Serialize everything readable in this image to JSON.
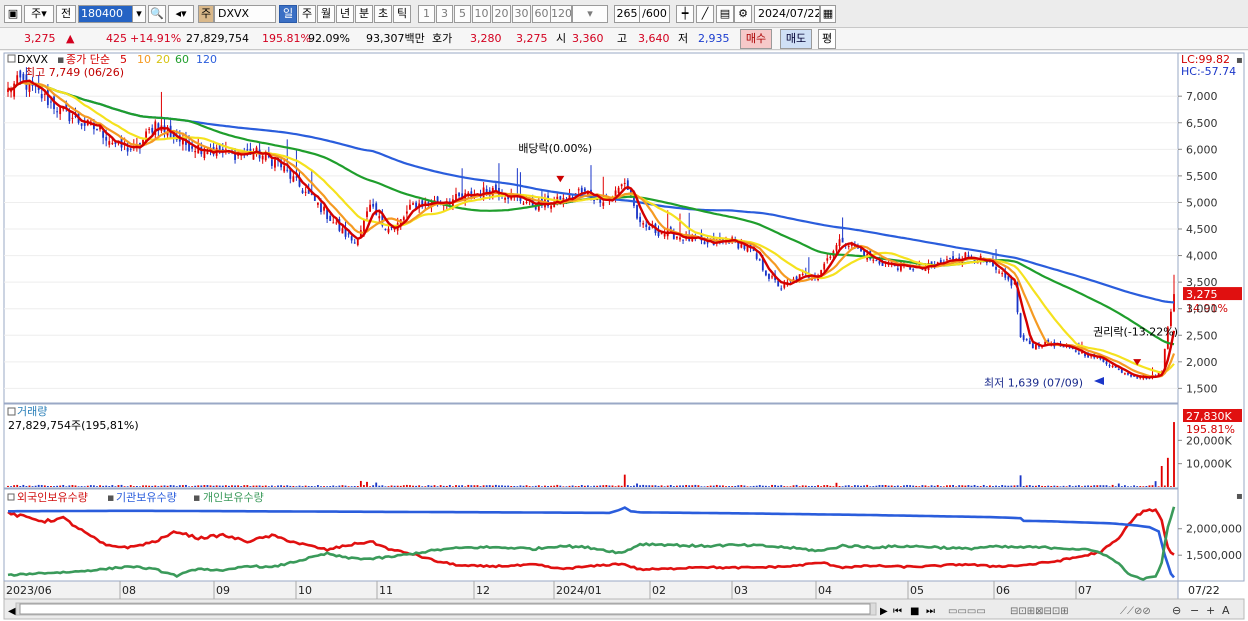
{
  "toolbar": {
    "period_label": "주",
    "prev_label": "전",
    "code": "180400",
    "type_label": "주",
    "name": "DXVX",
    "intervals": [
      "일",
      "주",
      "월",
      "년",
      "분",
      "초",
      "틱"
    ],
    "selected_interval": "일",
    "minutes": [
      "1",
      "3",
      "5",
      "10",
      "20",
      "30",
      "60",
      "120"
    ],
    "count": "265",
    "count_total": "/600",
    "date": "2024/07/22"
  },
  "pricebar": {
    "price": "3,275",
    "change_arrow": "▲",
    "change": "425",
    "change_pct": "+14.91%",
    "volume": "27,829,754",
    "volume_pct": "195.81%",
    "ratio": "92.09%",
    "amount": "93,307백만",
    "quote_label": "호가",
    "bid": "3,280",
    "ask": "3,275",
    "open_label": "시",
    "open": "3,360",
    "high_label": "고",
    "high": "3,640",
    "low_label": "저",
    "low": "2,935",
    "buy_label": "매수",
    "sell_label": "매도",
    "avg_label": "평"
  },
  "colors": {
    "candle_up": "#e00000",
    "candle_down": "#1a36c8",
    "ma5": "#d40000",
    "ma10": "#f59a22",
    "ma20": "#f5e21e",
    "ma60": "#1f9e2c",
    "ma120": "#2a5ddc",
    "foreign": "#e01010",
    "inst": "#2a5ddc",
    "retail": "#3a9a5a"
  },
  "chart_data": [
    {
      "type": "candlestick",
      "title": "DXVX",
      "legend": {
        "label": "종가 단순",
        "periods": [
          "5",
          "10",
          "20",
          "60",
          "120"
        ]
      },
      "annotations": {
        "high": "최고 7,749 (06/26)",
        "low": "최저 1,639 (07/09)",
        "dividend": "배당락(0.00%)",
        "rights": "권리락(-13.22%)"
      },
      "y_ticks": [
        "7,000",
        "6,500",
        "6,000",
        "5,500",
        "5,000",
        "4,500",
        "4,000",
        "3,500",
        "3,000",
        "2,500",
        "2,000",
        "1,500"
      ],
      "ylim": [
        1300,
        7700
      ],
      "lc": "LC:99.82",
      "hc": "HC:-57.74",
      "last_price": "3,275",
      "last_pct": "14.91%",
      "x_labels": [
        "2023/06",
        "08",
        "09",
        "10",
        "11",
        "12",
        "2024/01",
        "02",
        "03",
        "04",
        "05",
        "06",
        "07",
        "07/22"
      ],
      "keypoints": [
        [
          0,
          7100
        ],
        [
          4,
          7300
        ],
        [
          10,
          7050
        ],
        [
          18,
          6700
        ],
        [
          24,
          6500
        ],
        [
          30,
          6350
        ],
        [
          36,
          6050
        ],
        [
          42,
          6000
        ],
        [
          48,
          6500
        ],
        [
          52,
          6300
        ],
        [
          58,
          6100
        ],
        [
          65,
          6000
        ],
        [
          72,
          5900
        ],
        [
          80,
          5950
        ],
        [
          88,
          5750
        ],
        [
          95,
          5300
        ],
        [
          102,
          4900
        ],
        [
          108,
          4500
        ],
        [
          113,
          4250
        ],
        [
          118,
          4900
        ],
        [
          122,
          4600
        ],
        [
          126,
          4500
        ],
        [
          132,
          4950
        ],
        [
          138,
          5000
        ],
        [
          145,
          5050
        ],
        [
          152,
          5150
        ],
        [
          158,
          5250
        ],
        [
          165,
          5100
        ],
        [
          172,
          4950
        ],
        [
          178,
          5000
        ],
        [
          182,
          5050
        ],
        [
          186,
          5200
        ],
        [
          192,
          5100
        ],
        [
          196,
          5050
        ],
        [
          199,
          5250
        ],
        [
          201,
          5400
        ],
        [
          203,
          5100
        ],
        [
          206,
          4550
        ],
        [
          212,
          4450
        ],
        [
          220,
          4350
        ],
        [
          228,
          4200
        ],
        [
          235,
          4300
        ],
        [
          242,
          4100
        ],
        [
          248,
          3600
        ],
        [
          252,
          3400
        ],
        [
          258,
          3600
        ],
        [
          264,
          3650
        ],
        [
          268,
          4050
        ],
        [
          272,
          4300
        ],
        [
          276,
          4150
        ],
        [
          282,
          3900
        ],
        [
          290,
          3800
        ],
        [
          298,
          3750
        ],
        [
          306,
          3900
        ],
        [
          312,
          4000
        ],
        [
          318,
          3900
        ],
        [
          324,
          3600
        ],
        [
          328,
          3450
        ],
        [
          330,
          2450
        ],
        [
          334,
          2300
        ],
        [
          340,
          2350
        ],
        [
          348,
          2200
        ],
        [
          356,
          2050
        ],
        [
          362,
          1850
        ],
        [
          366,
          1750
        ],
        [
          372,
          1700
        ],
        [
          376,
          1800
        ],
        [
          378,
          2700
        ],
        [
          380,
          3275
        ]
      ],
      "total_days": 381,
      "dividend_day": 180,
      "rights_day": 368
    },
    {
      "type": "bar",
      "title": "거래량",
      "value_label": "27,829,754주(195,81%)",
      "y_ticks": [
        "20,000K",
        "10,000K"
      ],
      "ylim": [
        0,
        30000
      ],
      "last_label": "27,830K",
      "last_pct": "195.81%",
      "spikes": [
        [
          115,
          2600
        ],
        [
          117,
          2200
        ],
        [
          120,
          1900
        ],
        [
          201,
          5300
        ],
        [
          205,
          1500
        ],
        [
          270,
          1800
        ],
        [
          330,
          5000
        ],
        [
          362,
          1500
        ],
        [
          374,
          2500
        ],
        [
          376,
          9000
        ],
        [
          378,
          12500
        ],
        [
          380,
          27830
        ]
      ]
    },
    {
      "type": "line",
      "series": [
        {
          "name": "외국인보유수량",
          "key": "foreign",
          "values": [
            [
              0,
              2290000
            ],
            [
              5,
              2230000
            ],
            [
              12,
              2140000
            ],
            [
              18,
              2200000
            ],
            [
              25,
              1930000
            ],
            [
              32,
              1680000
            ],
            [
              40,
              1650000
            ],
            [
              48,
              1760000
            ],
            [
              55,
              1950000
            ],
            [
              62,
              1820000
            ],
            [
              70,
              1880000
            ],
            [
              78,
              1760000
            ],
            [
              86,
              1870000
            ],
            [
              95,
              1720000
            ],
            [
              104,
              1600000
            ],
            [
              110,
              1680000
            ],
            [
              118,
              1760000
            ],
            [
              125,
              1600000
            ],
            [
              132,
              1520000
            ],
            [
              140,
              1380000
            ],
            [
              148,
              1300000
            ],
            [
              156,
              1290000
            ],
            [
              164,
              1300000
            ],
            [
              172,
              1320000
            ],
            [
              180,
              1240000
            ],
            [
              190,
              1290000
            ],
            [
              200,
              1340000
            ],
            [
              206,
              1230000
            ],
            [
              215,
              1240000
            ],
            [
              225,
              1280000
            ],
            [
              235,
              1260000
            ],
            [
              245,
              1270000
            ],
            [
              255,
              1290000
            ],
            [
              265,
              1360000
            ],
            [
              272,
              1270000
            ],
            [
              282,
              1300000
            ],
            [
              292,
              1280000
            ],
            [
              300,
              1290000
            ],
            [
              312,
              1330000
            ],
            [
              320,
              1290000
            ],
            [
              328,
              1300000
            ],
            [
              334,
              1330000
            ],
            [
              342,
              1390000
            ],
            [
              350,
              1480000
            ],
            [
              356,
              1560000
            ],
            [
              362,
              1810000
            ],
            [
              366,
              2150000
            ],
            [
              370,
              2340000
            ],
            [
              374,
              2350000
            ],
            [
              376,
              2150000
            ],
            [
              378,
              1630000
            ],
            [
              380,
              1500000
            ]
          ]
        },
        {
          "name": "기관보유수량",
          "key": "inst",
          "values": [
            [
              0,
              2330000
            ],
            [
              40,
              2340000
            ],
            [
              80,
              2330000
            ],
            [
              120,
              2320000
            ],
            [
              160,
              2310000
            ],
            [
              196,
              2300000
            ],
            [
              199,
              2350000
            ],
            [
              201,
              2400000
            ],
            [
              203,
              2330000
            ],
            [
              206,
              2310000
            ],
            [
              240,
              2290000
            ],
            [
              280,
              2260000
            ],
            [
              320,
              2220000
            ],
            [
              330,
              2200000
            ],
            [
              331,
              2150000
            ],
            [
              340,
              2140000
            ],
            [
              350,
              2120000
            ],
            [
              360,
              2100000
            ],
            [
              368,
              2060000
            ],
            [
              372,
              2030000
            ],
            [
              375,
              1950000
            ],
            [
              377,
              1500000
            ],
            [
              379,
              1150000
            ],
            [
              380,
              1080000
            ]
          ]
        },
        {
          "name": "개인보유수량",
          "key": "retail",
          "values": [
            [
              0,
              1120000
            ],
            [
              10,
              1160000
            ],
            [
              20,
              1180000
            ],
            [
              30,
              1230000
            ],
            [
              40,
              1290000
            ],
            [
              48,
              1230000
            ],
            [
              55,
              1110000
            ],
            [
              62,
              1250000
            ],
            [
              70,
              1200000
            ],
            [
              78,
              1300000
            ],
            [
              86,
              1270000
            ],
            [
              95,
              1400000
            ],
            [
              104,
              1530000
            ],
            [
              110,
              1450000
            ],
            [
              118,
              1430000
            ],
            [
              125,
              1470000
            ],
            [
              132,
              1530000
            ],
            [
              140,
              1600000
            ],
            [
              148,
              1640000
            ],
            [
              156,
              1650000
            ],
            [
              164,
              1640000
            ],
            [
              172,
              1620000
            ],
            [
              180,
              1680000
            ],
            [
              190,
              1640000
            ],
            [
              200,
              1540000
            ],
            [
              206,
              1710000
            ],
            [
              215,
              1700000
            ],
            [
              225,
              1670000
            ],
            [
              235,
              1690000
            ],
            [
              245,
              1680000
            ],
            [
              255,
              1640000
            ],
            [
              265,
              1580000
            ],
            [
              272,
              1680000
            ],
            [
              282,
              1650000
            ],
            [
              292,
              1670000
            ],
            [
              300,
              1660000
            ],
            [
              312,
              1620000
            ],
            [
              320,
              1660000
            ],
            [
              328,
              1650000
            ],
            [
              334,
              1650000
            ],
            [
              342,
              1640000
            ],
            [
              350,
              1610000
            ],
            [
              356,
              1560000
            ],
            [
              362,
              1340000
            ],
            [
              366,
              1110000
            ],
            [
              370,
              1050000
            ],
            [
              374,
              1100000
            ],
            [
              376,
              1350000
            ],
            [
              378,
              2050000
            ],
            [
              380,
              2400000
            ]
          ]
        }
      ],
      "y_ticks": [
        "2,000,000",
        "1,500,000"
      ],
      "ylim": [
        1050000,
        2600000
      ]
    }
  ]
}
